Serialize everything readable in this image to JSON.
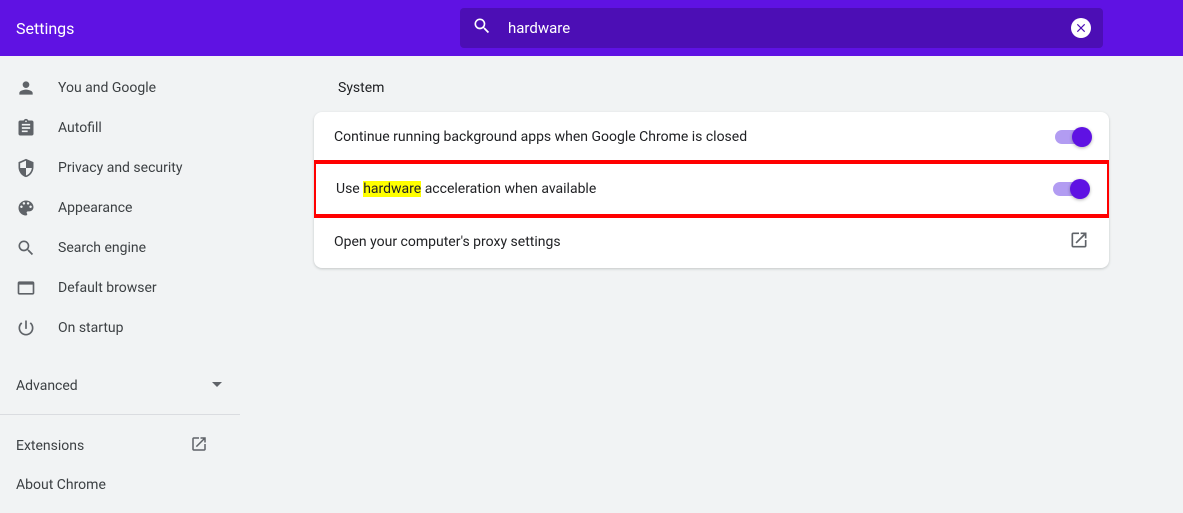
{
  "header": {
    "title": "Settings"
  },
  "search": {
    "value": "hardware"
  },
  "sidebar": {
    "items": [
      {
        "label": "You and Google"
      },
      {
        "label": "Autofill"
      },
      {
        "label": "Privacy and security"
      },
      {
        "label": "Appearance"
      },
      {
        "label": "Search engine"
      },
      {
        "label": "Default browser"
      },
      {
        "label": "On startup"
      }
    ],
    "advanced": "Advanced",
    "extensions": "Extensions",
    "about": "About Chrome"
  },
  "main": {
    "section_title": "System",
    "rows": [
      {
        "label_prefix": "",
        "label_highlight": "",
        "label_suffix": "Continue running background apps when Google Chrome is closed",
        "type": "toggle",
        "on": true
      },
      {
        "label_prefix": "Use ",
        "label_highlight": "hardware",
        "label_suffix": " acceleration when available",
        "type": "toggle",
        "on": true,
        "emphasized": true
      },
      {
        "label_prefix": "",
        "label_highlight": "",
        "label_suffix": "Open your computer's proxy settings",
        "type": "link"
      }
    ]
  }
}
